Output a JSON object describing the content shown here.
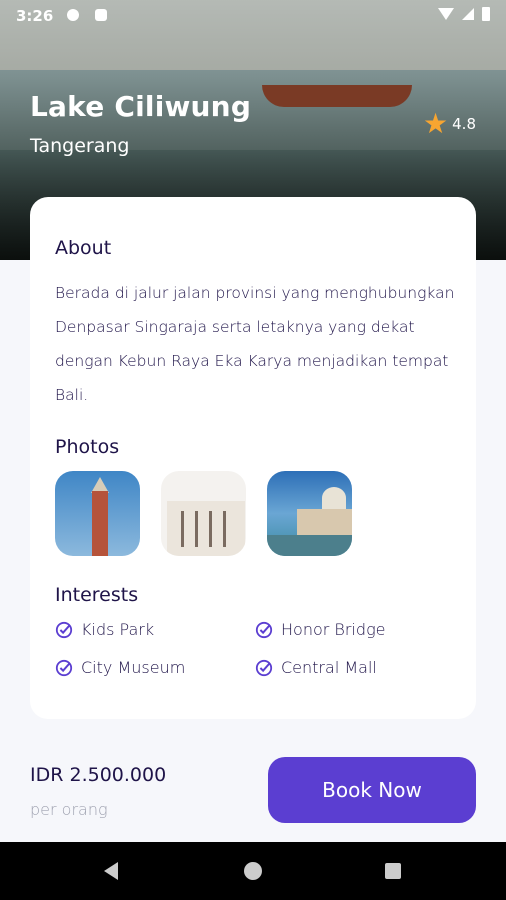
{
  "status": {
    "time": "3:26"
  },
  "destination": {
    "title": "Lake Ciliwung",
    "location": "Tangerang",
    "rating": "4.8"
  },
  "about": {
    "heading": "About",
    "text": "Berada di jalur jalan provinsi yang menghubungkan Denpasar Singaraja serta letaknya yang dekat dengan Kebun Raya Eka Karya menjadikan tempat Bali."
  },
  "photos": {
    "heading": "Photos"
  },
  "interests": {
    "heading": "Interests",
    "items": [
      "Kids Park",
      "Honor Bridge",
      "City Museum",
      "Central Mall"
    ]
  },
  "footer": {
    "price": "IDR 2.500.000",
    "per": "per orang",
    "book_label": "Book Now"
  },
  "colors": {
    "accent": "#5b3ed1",
    "text": "#1f1449",
    "muted": "#a0a3b1",
    "star": "#f7a531"
  }
}
